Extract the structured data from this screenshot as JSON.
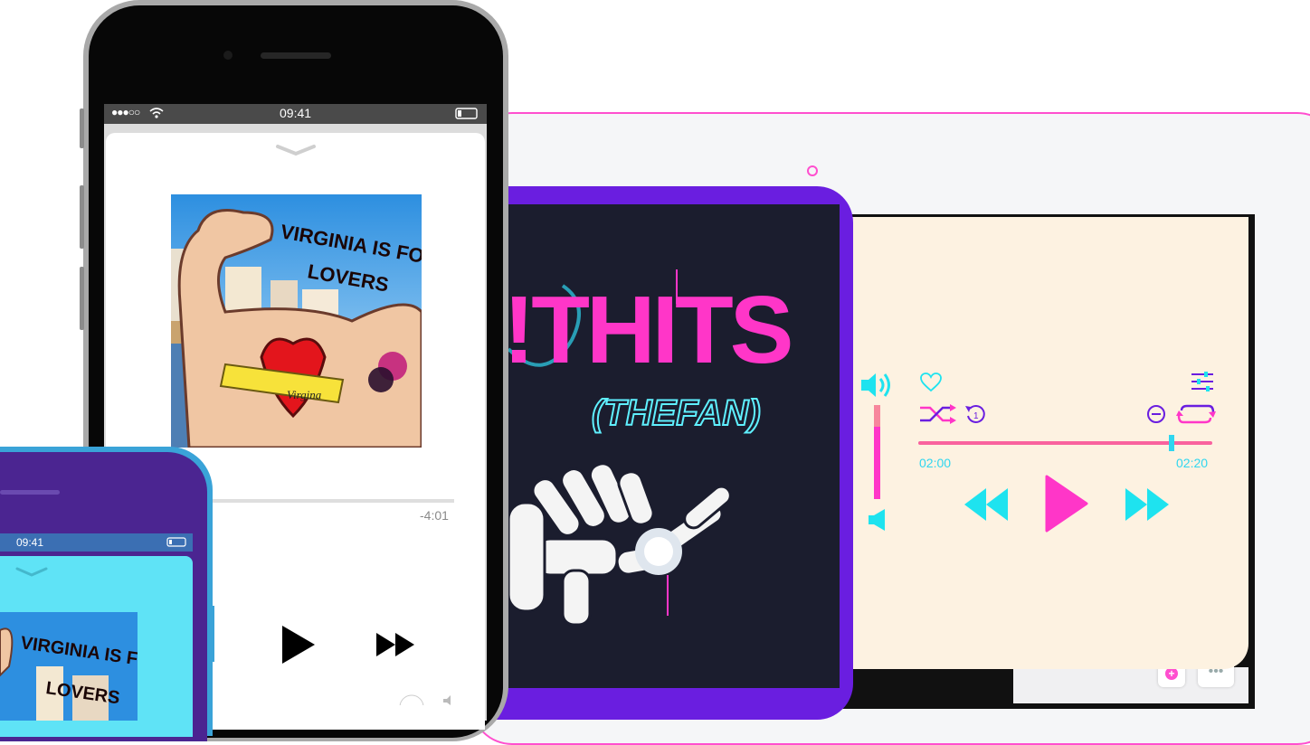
{
  "phone": {
    "status": {
      "carrier_dots": "●●●○○",
      "time": "09:41"
    },
    "sheet": {
      "time_remaining": "-4:01"
    },
    "album_art": {
      "title_text": "VIRGINIA IS FOR LOVERS",
      "banner_text": "Virgina"
    }
  },
  "phone2": {
    "status": {
      "time": "09:41"
    },
    "album_art": {
      "title_text": "VIRGINIA IS FOR LOVERS"
    }
  },
  "tablet": {
    "cover": {
      "title_text": "!THITS",
      "subtitle_text": "(THEFAN)"
    },
    "player": {
      "time_elapsed": "02:00",
      "time_total": "02:20",
      "progress": 0.86
    }
  },
  "colors": {
    "accent_pink": "#ff36c8",
    "accent_cyan": "#1ee3ef",
    "accent_purple": "#6a1ee0",
    "player_bg": "#fdf2e1"
  },
  "icons": [
    "wifi-icon",
    "battery-icon",
    "chevron-down-icon",
    "play-icon",
    "fast-forward-icon",
    "volume-icon",
    "heart-icon",
    "equalizer-icon",
    "shuffle-icon",
    "replay-one-icon",
    "minus-circle-icon",
    "repeat-icon",
    "rewind-icon",
    "plus-icon",
    "more-icon"
  ]
}
